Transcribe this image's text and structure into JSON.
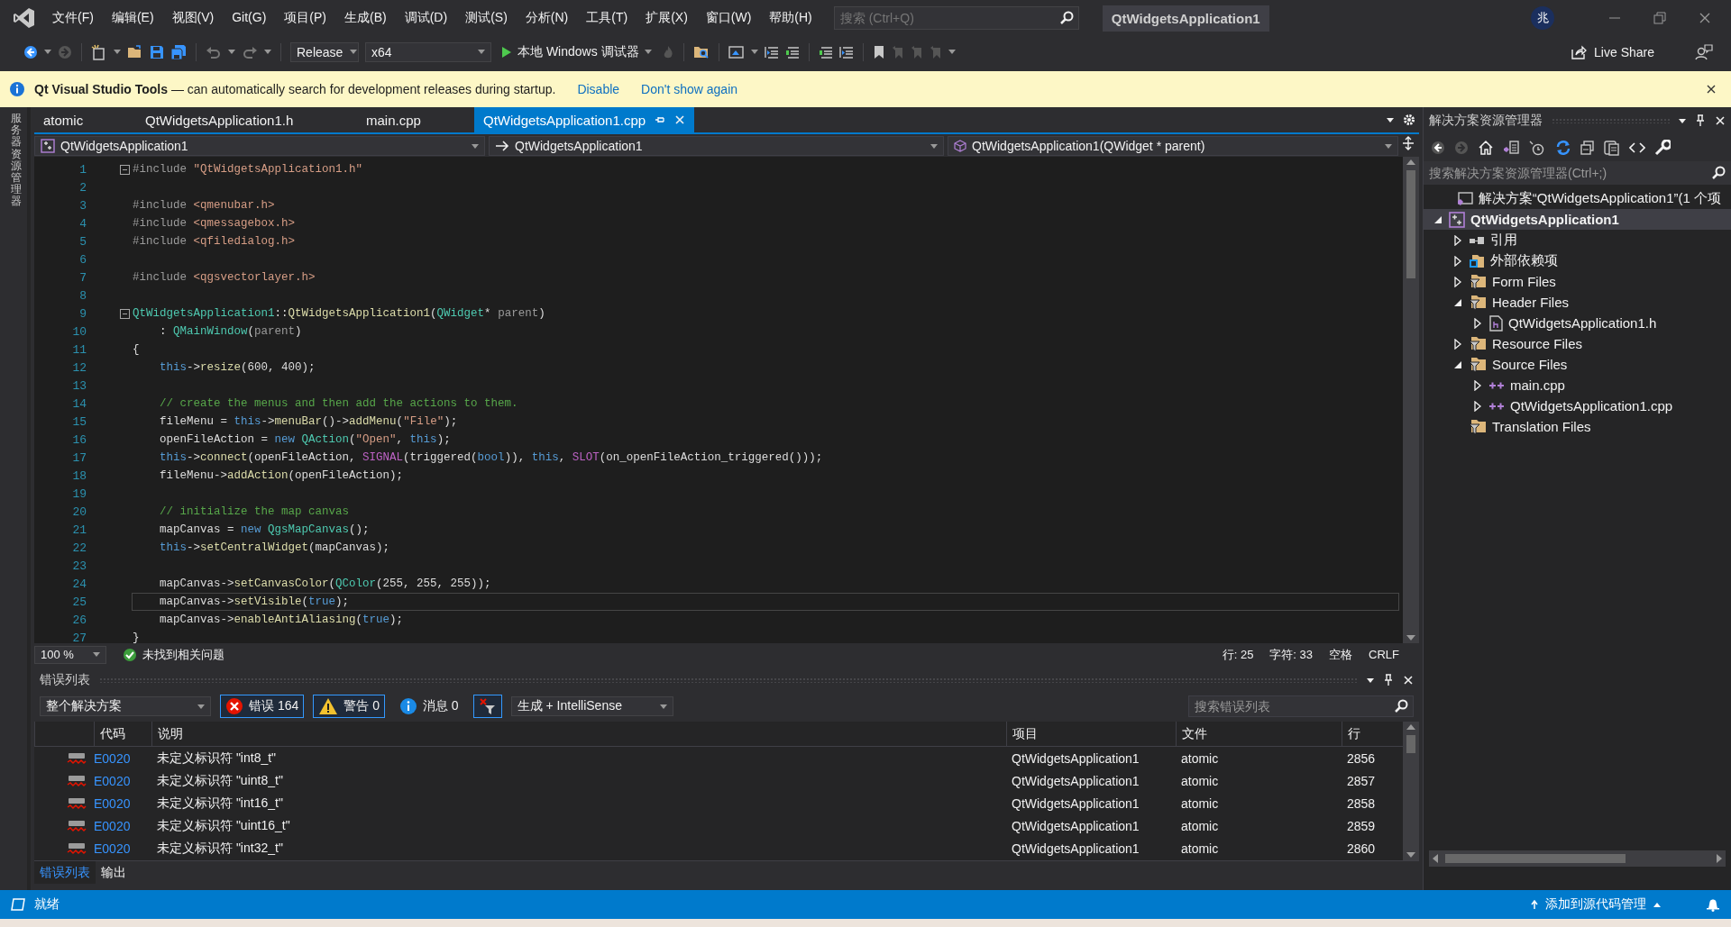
{
  "title_bar": {
    "menu": [
      "文件(F)",
      "编辑(E)",
      "视图(V)",
      "Git(G)",
      "项目(P)",
      "生成(B)",
      "调试(D)",
      "测试(S)",
      "分析(N)",
      "工具(T)",
      "扩展(X)",
      "窗口(W)",
      "帮助(H)"
    ],
    "search": {
      "placeholder": "搜索 (Ctrl+Q)"
    },
    "solution_name": "QtWidgetsApplication1",
    "avatar": "兆"
  },
  "toolbar": {
    "configuration": "Release",
    "platform": "x64",
    "debug_target": "本地 Windows 调试器",
    "live_share": "Live Share"
  },
  "info_bar": {
    "message": "**Qt Visual Studio Tools** — can automatically search for development releases during startup.",
    "links": [
      "Disable",
      "Don't show again"
    ]
  },
  "side_strip": {
    "label": "服务器资源管理器"
  },
  "editor": {
    "tabs": [
      {
        "label": "atomic",
        "selected": false
      },
      {
        "label": "QtWidgetsApplication1.h",
        "selected": false
      },
      {
        "label": "main.cpp",
        "selected": false
      },
      {
        "label": "QtWidgetsApplication1.cpp",
        "selected": true
      }
    ],
    "nav": {
      "scope": "QtWidgetsApplication1",
      "type": "QtWidgetsApplication1",
      "member": "QtWidgetsApplication1(QWidget * parent)"
    },
    "lines": [
      {
        "n": "1",
        "fold": true,
        "current": false,
        "seg": [
          {
            "kind": "pp",
            "text": "#include "
          },
          {
            "kind": "str",
            "text": "\"QtWidgetsApplication1.h\""
          }
        ]
      },
      {
        "n": "2",
        "fold": false,
        "current": false
      },
      {
        "n": "3",
        "fold": false,
        "current": false,
        "seg": [
          {
            "kind": "pp",
            "text": "#include "
          },
          {
            "kind": "str",
            "text": "<qmenubar.h>"
          }
        ]
      },
      {
        "n": "4",
        "fold": false,
        "current": false,
        "seg": [
          {
            "kind": "pp",
            "text": "#include "
          },
          {
            "kind": "str",
            "text": "<qmessagebox.h>"
          }
        ]
      },
      {
        "n": "5",
        "fold": false,
        "current": false,
        "seg": [
          {
            "kind": "pp",
            "text": "#include "
          },
          {
            "kind": "str",
            "text": "<qfiledialog.h>"
          }
        ]
      },
      {
        "n": "6",
        "fold": false,
        "current": false
      },
      {
        "n": "7",
        "fold": false,
        "current": false,
        "seg": [
          {
            "kind": "pp",
            "text": "#include "
          },
          {
            "kind": "str",
            "text": "<qgsvectorlayer.h>"
          }
        ]
      },
      {
        "n": "8",
        "fold": false,
        "current": false
      },
      {
        "n": "9",
        "fold": true,
        "current": false,
        "seg": [
          {
            "kind": "type",
            "text": "QtWidgetsApplication1"
          },
          {
            "kind": "plain",
            "text": "::"
          },
          {
            "kind": "fn",
            "text": "QtWidgetsApplication1"
          },
          {
            "kind": "plain",
            "text": "("
          },
          {
            "kind": "type",
            "text": "QWidget"
          },
          {
            "kind": "plain",
            "text": "* "
          },
          {
            "kind": "param",
            "text": "parent"
          },
          {
            "kind": "plain",
            "text": ")"
          }
        ]
      },
      {
        "n": "10",
        "fold": false,
        "current": false,
        "seg": [
          {
            "kind": "plain",
            "text": "    : "
          },
          {
            "kind": "type",
            "text": "QMainWindow"
          },
          {
            "kind": "plain",
            "text": "("
          },
          {
            "kind": "param",
            "text": "parent"
          },
          {
            "kind": "plain",
            "text": ")"
          }
        ]
      },
      {
        "n": "11",
        "fold": false,
        "current": false,
        "seg": [
          {
            "kind": "plain",
            "text": "{"
          }
        ]
      },
      {
        "n": "12",
        "fold": false,
        "current": false,
        "seg": [
          {
            "kind": "kw",
            "text": "    this"
          },
          {
            "kind": "plain",
            "text": "->"
          },
          {
            "kind": "fn",
            "text": "resize"
          },
          {
            "kind": "plain",
            "text": "(600, 400);"
          }
        ]
      },
      {
        "n": "13",
        "fold": false,
        "current": false
      },
      {
        "n": "14",
        "fold": false,
        "current": false,
        "seg": [
          {
            "kind": "cmt",
            "text": "    // create the menus and then add the actions to them."
          }
        ]
      },
      {
        "n": "15",
        "fold": false,
        "current": false,
        "seg": [
          {
            "kind": "plain",
            "text": "    fileMenu = "
          },
          {
            "kind": "kw",
            "text": "this"
          },
          {
            "kind": "plain",
            "text": "->"
          },
          {
            "kind": "fn",
            "text": "menuBar"
          },
          {
            "kind": "plain",
            "text": "()->"
          },
          {
            "kind": "fn",
            "text": "addMenu"
          },
          {
            "kind": "plain",
            "text": "("
          },
          {
            "kind": "str",
            "text": "\"File\""
          },
          {
            "kind": "plain",
            "text": ");"
          }
        ]
      },
      {
        "n": "16",
        "fold": false,
        "current": false,
        "seg": [
          {
            "kind": "plain",
            "text": "    openFileAction = "
          },
          {
            "kind": "kw",
            "text": "new "
          },
          {
            "kind": "type",
            "text": "QAction"
          },
          {
            "kind": "plain",
            "text": "("
          },
          {
            "kind": "str",
            "text": "\"Open\""
          },
          {
            "kind": "plain",
            "text": ", "
          },
          {
            "kind": "kw",
            "text": "this"
          },
          {
            "kind": "plain",
            "text": ");"
          }
        ]
      },
      {
        "n": "17",
        "fold": false,
        "current": false,
        "seg": [
          {
            "kind": "kw",
            "text": "    this"
          },
          {
            "kind": "plain",
            "text": "->"
          },
          {
            "kind": "fn",
            "text": "connect"
          },
          {
            "kind": "plain",
            "text": "(openFileAction, "
          },
          {
            "kind": "mac",
            "text": "SIGNAL"
          },
          {
            "kind": "plain",
            "text": "(triggered("
          },
          {
            "kind": "kw",
            "text": "bool"
          },
          {
            "kind": "plain",
            "text": ")), "
          },
          {
            "kind": "kw",
            "text": "this"
          },
          {
            "kind": "plain",
            "text": ", "
          },
          {
            "kind": "mac",
            "text": "SLOT"
          },
          {
            "kind": "plain",
            "text": "(on_openFileAction_triggered()));"
          }
        ]
      },
      {
        "n": "18",
        "fold": false,
        "current": false,
        "seg": [
          {
            "kind": "plain",
            "text": "    fileMenu->"
          },
          {
            "kind": "fn",
            "text": "addAction"
          },
          {
            "kind": "plain",
            "text": "(openFileAction);"
          }
        ]
      },
      {
        "n": "19",
        "fold": false,
        "current": false
      },
      {
        "n": "20",
        "fold": false,
        "current": false,
        "seg": [
          {
            "kind": "cmt",
            "text": "    // initialize the map canvas"
          }
        ]
      },
      {
        "n": "21",
        "fold": false,
        "current": false,
        "seg": [
          {
            "kind": "plain",
            "text": "    mapCanvas = "
          },
          {
            "kind": "kw",
            "text": "new "
          },
          {
            "kind": "type",
            "text": "QgsMapCanvas"
          },
          {
            "kind": "plain",
            "text": "();"
          }
        ]
      },
      {
        "n": "22",
        "fold": false,
        "current": false,
        "seg": [
          {
            "kind": "kw",
            "text": "    this"
          },
          {
            "kind": "plain",
            "text": "->"
          },
          {
            "kind": "fn",
            "text": "setCentralWidget"
          },
          {
            "kind": "plain",
            "text": "(mapCanvas);"
          }
        ]
      },
      {
        "n": "23",
        "fold": false,
        "current": false
      },
      {
        "n": "24",
        "fold": false,
        "current": false,
        "seg": [
          {
            "kind": "plain",
            "text": "    mapCanvas->"
          },
          {
            "kind": "fn",
            "text": "setCanvasColor"
          },
          {
            "kind": "plain",
            "text": "("
          },
          {
            "kind": "type",
            "text": "QColor"
          },
          {
            "kind": "plain",
            "text": "(255, 255, 255));"
          }
        ]
      },
      {
        "n": "25",
        "fold": false,
        "current": true,
        "seg": [
          {
            "kind": "plain",
            "text": "    mapCanvas->"
          },
          {
            "kind": "fn",
            "text": "setVisible"
          },
          {
            "kind": "plain",
            "text": "("
          },
          {
            "kind": "kw",
            "text": "true"
          },
          {
            "kind": "plain",
            "text": ");"
          }
        ]
      },
      {
        "n": "26",
        "fold": false,
        "current": false,
        "seg": [
          {
            "kind": "plain",
            "text": "    mapCanvas->"
          },
          {
            "kind": "fn",
            "text": "enableAntiAliasing"
          },
          {
            "kind": "plain",
            "text": "("
          },
          {
            "kind": "kw",
            "text": "true"
          },
          {
            "kind": "plain",
            "text": ");"
          }
        ]
      },
      {
        "n": "27",
        "fold": false,
        "current": false,
        "seg": [
          {
            "kind": "plain",
            "text": "}"
          }
        ]
      }
    ],
    "status": {
      "zoom": "100 %",
      "issues": "未找到相关问题",
      "line": "行: 25",
      "column": "字符: 33",
      "indent": "空格",
      "eol": "CRLF"
    }
  },
  "error_list": {
    "title": "错误列表",
    "scope": "整个解决方案",
    "filters": [
      {
        "kind": "error",
        "label": "错误 164",
        "on": true
      },
      {
        "kind": "warning",
        "label": "警告 0",
        "on": true
      },
      {
        "kind": "message",
        "label": "消息 0",
        "on": false
      },
      {
        "kind": "filter",
        "on": true
      }
    ],
    "source": "生成 + IntelliSense",
    "search": {
      "placeholder": "搜索错误列表"
    },
    "columns": [
      "代码",
      "说明",
      "项目",
      "文件",
      "行"
    ],
    "rows": [
      {
        "code": "E0020",
        "description": "未定义标识符 \"int8_t\"",
        "project": "QtWidgetsApplication1",
        "file": "atomic",
        "line": "2856"
      },
      {
        "code": "E0020",
        "description": "未定义标识符 \"uint8_t\"",
        "project": "QtWidgetsApplication1",
        "file": "atomic",
        "line": "2857"
      },
      {
        "code": "E0020",
        "description": "未定义标识符 \"int16_t\"",
        "project": "QtWidgetsApplication1",
        "file": "atomic",
        "line": "2858"
      },
      {
        "code": "E0020",
        "description": "未定义标识符 \"uint16_t\"",
        "project": "QtWidgetsApplication1",
        "file": "atomic",
        "line": "2859"
      },
      {
        "code": "E0020",
        "description": "未定义标识符 \"int32_t\"",
        "project": "QtWidgetsApplication1",
        "file": "atomic",
        "line": "2860"
      }
    ],
    "tabs": [
      {
        "label": "错误列表",
        "selected": true
      },
      {
        "label": "输出",
        "selected": false
      }
    ]
  },
  "solution_explorer": {
    "title": "解决方案资源管理器",
    "search": {
      "placeholder": "搜索解决方案资源管理器(Ctrl+;)"
    },
    "tree": [
      {
        "label": "解决方案“QtWidgetsApplication1”(1 个项",
        "kind": "solution",
        "selected": false
      },
      {
        "label": "QtWidgetsApplication1",
        "kind": "project",
        "expanded": true,
        "selected": true,
        "children": [
          {
            "label": "引用",
            "kind": "references",
            "expanded": false,
            "selected": false
          },
          {
            "label": "外部依赖项",
            "kind": "external",
            "expanded": false,
            "selected": false
          },
          {
            "label": "Form Files",
            "kind": "filter",
            "expanded": false,
            "selected": false
          },
          {
            "label": "Header Files",
            "kind": "filter",
            "expanded": true,
            "selected": false,
            "children": [
              {
                "label": "QtWidgetsApplication1.h",
                "kind": "header",
                "expanded": false,
                "selected": false
              }
            ]
          },
          {
            "label": "Resource Files",
            "kind": "filter",
            "expanded": false,
            "selected": false
          },
          {
            "label": "Source Files",
            "kind": "filter",
            "expanded": true,
            "selected": false,
            "children": [
              {
                "label": "main.cpp",
                "kind": "source",
                "expanded": false,
                "selected": false
              },
              {
                "label": "QtWidgetsApplication1.cpp",
                "kind": "source",
                "expanded": false,
                "selected": false
              }
            ]
          },
          {
            "label": "Translation Files",
            "kind": "filter",
            "selected": false
          }
        ]
      }
    ]
  },
  "status_bar": {
    "message": "就绪",
    "source_control": "添加到源代码管理"
  }
}
